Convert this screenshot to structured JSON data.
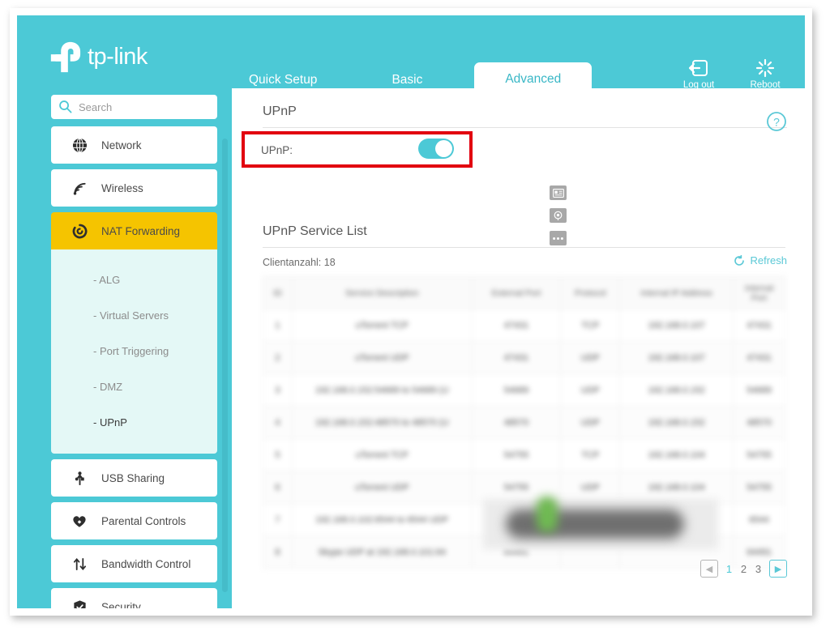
{
  "brand": {
    "name": "tp-link"
  },
  "header": {
    "tabs": [
      {
        "label": "Quick Setup",
        "active": false
      },
      {
        "label": "Basic",
        "active": false
      },
      {
        "label": "Advanced",
        "active": true
      }
    ],
    "actions": [
      {
        "label": "Log out",
        "icon": "logout-icon"
      },
      {
        "label": "Reboot",
        "icon": "reboot-icon"
      }
    ]
  },
  "search": {
    "placeholder": "Search",
    "value": "",
    "icon": "search-icon"
  },
  "sidebar": {
    "items": [
      {
        "label": "Network",
        "icon": "globe-icon",
        "active": false
      },
      {
        "label": "Wireless",
        "icon": "wifi-icon",
        "active": false
      },
      {
        "label": "NAT Forwarding",
        "icon": "nat-icon",
        "active": true
      },
      {
        "label": "USB Sharing",
        "icon": "usb-icon",
        "active": false
      },
      {
        "label": "Parental Controls",
        "icon": "heart-icon",
        "active": false
      },
      {
        "label": "Bandwidth Control",
        "icon": "updown-arrows-icon",
        "active": false
      },
      {
        "label": "Security",
        "icon": "shield-icon",
        "active": false
      }
    ],
    "submenu": [
      {
        "label": "- ALG",
        "active": false
      },
      {
        "label": "- Virtual Servers",
        "active": false
      },
      {
        "label": "- Port Triggering",
        "active": false
      },
      {
        "label": "- DMZ",
        "active": false
      },
      {
        "label": "- UPnP",
        "active": true
      }
    ]
  },
  "main": {
    "section_title": "UPnP",
    "upnp_label": "UPnP:",
    "upnp_enabled": true,
    "list_title": "UPnP Service List",
    "client_count": "Clientanzahl: 18",
    "refresh_label": "Refresh",
    "help_icon": "help-icon",
    "float_tools": [
      {
        "icon": "id-card-icon"
      },
      {
        "icon": "circle-badge-icon"
      },
      {
        "icon": "ellipsis-icon"
      }
    ],
    "table": {
      "columns": [
        "ID",
        "Service Description",
        "External Port",
        "Protocol",
        "Internal IP Address",
        "Internal Port"
      ],
      "rows": [
        [
          "1",
          "uTorrent TCP",
          "47431",
          "TCP",
          "192.168.0.107",
          "47431"
        ],
        [
          "2",
          "uTorrent UDP",
          "47431",
          "UDP",
          "192.168.0.107",
          "47431"
        ],
        [
          "3",
          "192.168.0.152:54689 to 54689 (U",
          "54689",
          "UDP",
          "192.168.0.152",
          "54689"
        ],
        [
          "4",
          "192.168.0.152:48570 to 48570 (U",
          "48570",
          "UDP",
          "192.168.0.152",
          "48570"
        ],
        [
          "5",
          "uTorrent TCP",
          "54755",
          "TCP",
          "192.168.0.104",
          "54755"
        ],
        [
          "6",
          "uTorrent UDP",
          "54755",
          "UDP",
          "192.168.0.104",
          "54755"
        ],
        [
          "7",
          "192.168.0.102:6544 to 6544 UDP",
          "6544",
          "",
          "",
          "6544"
        ],
        [
          "8",
          "Skype UDP at 192.168.0.101:64",
          "64491",
          "",
          "",
          "64491"
        ]
      ]
    },
    "pagination": {
      "prev_icon": "chevron-left-icon",
      "next_icon": "chevron-right-icon",
      "pages": [
        "1",
        "2",
        "3"
      ],
      "current": "1"
    }
  }
}
